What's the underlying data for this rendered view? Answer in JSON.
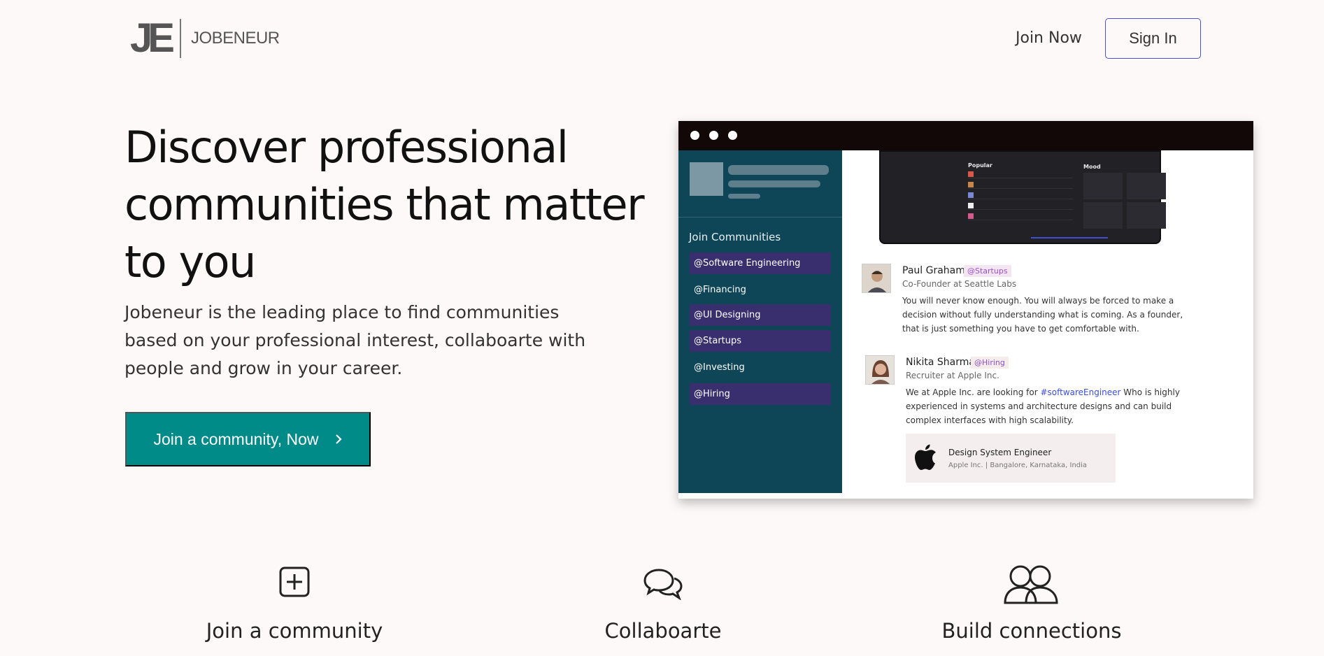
{
  "header": {
    "logo_mark": "JE",
    "logo_text": "JOBENEUR",
    "join_now": "Join Now",
    "sign_in": "Sign In"
  },
  "hero": {
    "title": "Discover professional communities that matter to you",
    "description": "Jobeneur is the leading place to find communities based on your professional interest, collaboarte with people and grow in your career.",
    "cta_label": "Join a community, Now",
    "cta_icon": "chevron-right-icon"
  },
  "mockup": {
    "sidebar_heading": "Join Communities",
    "communities": [
      {
        "label": "@Software Engineering",
        "active": true
      },
      {
        "label": "@Financing",
        "active": false
      },
      {
        "label": "@UI Designing",
        "active": true
      },
      {
        "label": "@Startups",
        "active": true
      },
      {
        "label": "@Investing",
        "active": false
      },
      {
        "label": "@Hiring",
        "active": true
      }
    ],
    "player": {
      "popular_label": "Popular",
      "mood_label": "Mood"
    },
    "posts": [
      {
        "name": "Paul Graham",
        "tag": "@Startups",
        "role": "Co-Founder at Seattle Labs",
        "body": "You will never know enough. You will always be forced to make a decision without fully understanding what is coming. As a founder, that is just something you have to get comfortable with."
      },
      {
        "name": "Nikita Sharma",
        "tag": "@Hiring",
        "role": "Recruiter at Apple Inc.",
        "body_before": "We at Apple Inc. are looking for ",
        "hashtag": "#softwareEngineer",
        "body_after": " Who is highly experienced in systems and architecture designs and can build complex interfaces with high scalability."
      }
    ],
    "job": {
      "title": "Design System Engineer",
      "location": "Apple Inc. | Bangalore, Karnataka, India",
      "icon": "apple-logo-icon"
    }
  },
  "features": [
    {
      "label": "Join a community",
      "icon": "plus-square-icon"
    },
    {
      "label": "Collaboarte",
      "icon": "chat-bubbles-icon"
    },
    {
      "label": "Build connections",
      "icon": "people-icon"
    }
  ],
  "colors": {
    "background": "#fdf9f8",
    "cta": "#008a88",
    "sign_in_border": "#4a4fd6",
    "sidebar": "#0e4658",
    "sidebar_active": "#3a2f6e"
  }
}
